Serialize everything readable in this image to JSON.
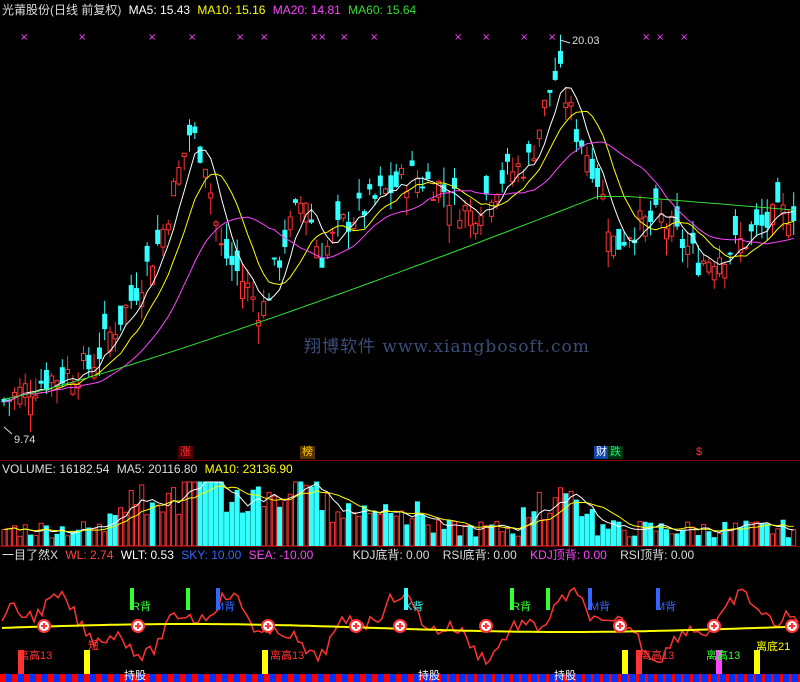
{
  "header": {
    "title": "光莆股份(日线 前复权)",
    "ma": [
      {
        "label": "MA5: 15.43",
        "color": "#ffffff"
      },
      {
        "label": "MA10: 15.16",
        "color": "#ffff00"
      },
      {
        "label": "MA20: 14.81",
        "color": "#ff44ff"
      },
      {
        "label": "MA60: 15.64",
        "color": "#33dd33"
      }
    ]
  },
  "price": {
    "high_label": "20.03",
    "low_label": "9.74",
    "events": [
      {
        "label": "涨",
        "color": "#ff3333",
        "bg": "#550000"
      },
      {
        "label": "榜",
        "color": "#ffcc00",
        "bg": "#553300"
      },
      {
        "label": "财",
        "color": "#ffffff",
        "bg": "#1144aa"
      },
      {
        "label": "跌",
        "color": "#00ff66",
        "bg": "#003311"
      },
      {
        "label": "$",
        "color": "#ff3333",
        "bg": "#000000"
      }
    ],
    "watermark": "翔博软件 www.xiangbosoft.com"
  },
  "volume": {
    "vol": "VOLUME: 16182.54",
    "ma5": "MA5: 20116.80",
    "ma10": "MA10: 23136.90"
  },
  "indicator": {
    "name": "一目了然X",
    "items": [
      {
        "label": "WL: 2.74",
        "color": "#ff4444"
      },
      {
        "label": "WLT: 0.53",
        "color": "#ffffff"
      },
      {
        "label": "SKY: 10.00",
        "color": "#3366ff"
      },
      {
        "label": "SEA: -10.00",
        "color": "#ff44ff"
      },
      {
        "label": "KDJ底背: 0.00",
        "color": "#dddddd"
      },
      {
        "label": "RSI底背: 0.00",
        "color": "#dddddd"
      },
      {
        "label": "KDJ顶背: 0.00",
        "color": "#ff44ff"
      },
      {
        "label": "RSI顶背: 0.00",
        "color": "#dddddd"
      }
    ],
    "signals": {
      "r_top": "R背",
      "m_top": "M背",
      "k_top": "K背",
      "dip13": "离高13",
      "bottom21": "离底21",
      "hold": "持股",
      "short": "短"
    }
  },
  "colors": {
    "up": "#ff3333",
    "down": "#33ffff",
    "ma5": "#ffffff",
    "ma10": "#ffff00",
    "ma20": "#ff44ff",
    "ma60": "#33dd33"
  }
}
